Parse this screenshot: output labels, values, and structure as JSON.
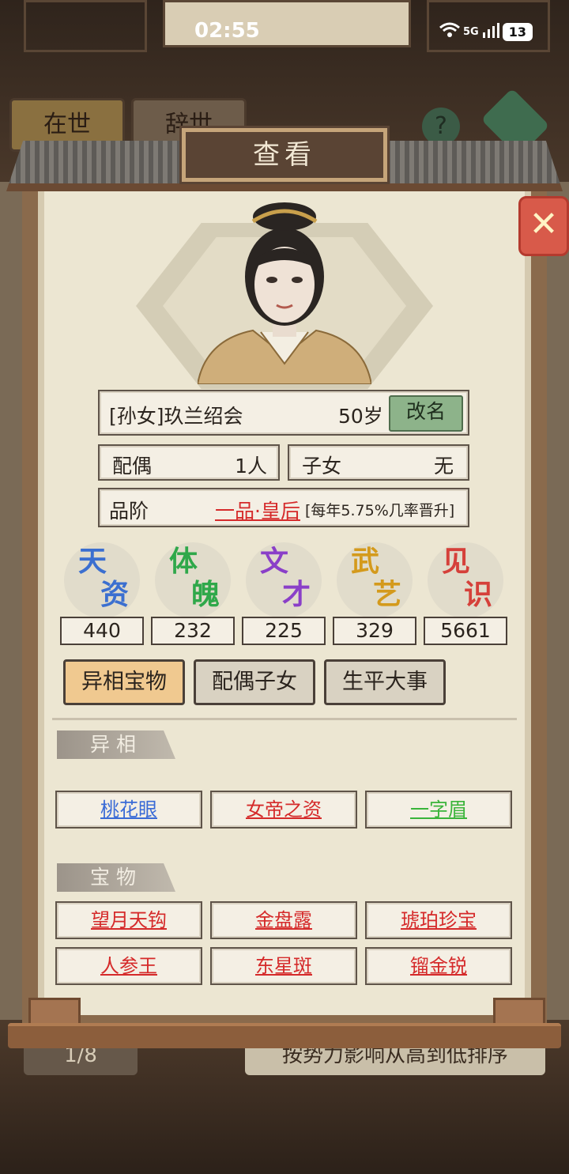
{
  "status_bar": {
    "time": "02:55",
    "signal": "5G",
    "battery": "13"
  },
  "background": {
    "tab_alive": "在世",
    "tab_deceased": "辞世",
    "help": "?",
    "pager": "1/8",
    "sort_hint": "按势力影响从高到低排序"
  },
  "dialog": {
    "title": "查看",
    "close": "✕"
  },
  "character": {
    "name": "[孙女]玖兰绍会",
    "age": "50岁",
    "rename_label": "改名",
    "spouse_label": "配偶",
    "spouse_value": "1人",
    "children_label": "子女",
    "children_value": "无",
    "rank_label": "品阶",
    "rank_value": "一品·皇后",
    "rank_note": "[每年5.75%几率晋升]"
  },
  "stats": [
    {
      "line1": "天",
      "line2": "资",
      "value": "440",
      "color": "#3b6fd0"
    },
    {
      "line1": "体",
      "line2": "魄",
      "value": "232",
      "color": "#2fa84a"
    },
    {
      "line1": "文",
      "line2": "才",
      "value": "225",
      "color": "#8a3fc8"
    },
    {
      "line1": "武",
      "line2": "艺",
      "value": "329",
      "color": "#d49a1c"
    },
    {
      "line1": "见",
      "line2": "识",
      "value": "5661",
      "color": "#d5403a"
    }
  ],
  "tabs": [
    "异相宝物",
    "配偶子女",
    "生平大事"
  ],
  "sections": {
    "traits_title": "异相",
    "traits": [
      {
        "label": "桃花眼",
        "color": "blue"
      },
      {
        "label": "女帝之资",
        "color": "red"
      },
      {
        "label": "一字眉",
        "color": "green"
      }
    ],
    "treasures_title": "宝物",
    "treasures": [
      {
        "label": "望月天钩",
        "color": "red"
      },
      {
        "label": "金盘露",
        "color": "red"
      },
      {
        "label": "琥珀珍宝",
        "color": "red"
      },
      {
        "label": "人参王",
        "color": "red"
      },
      {
        "label": "东星斑",
        "color": "red"
      },
      {
        "label": "镏金锐",
        "color": "red"
      }
    ]
  }
}
